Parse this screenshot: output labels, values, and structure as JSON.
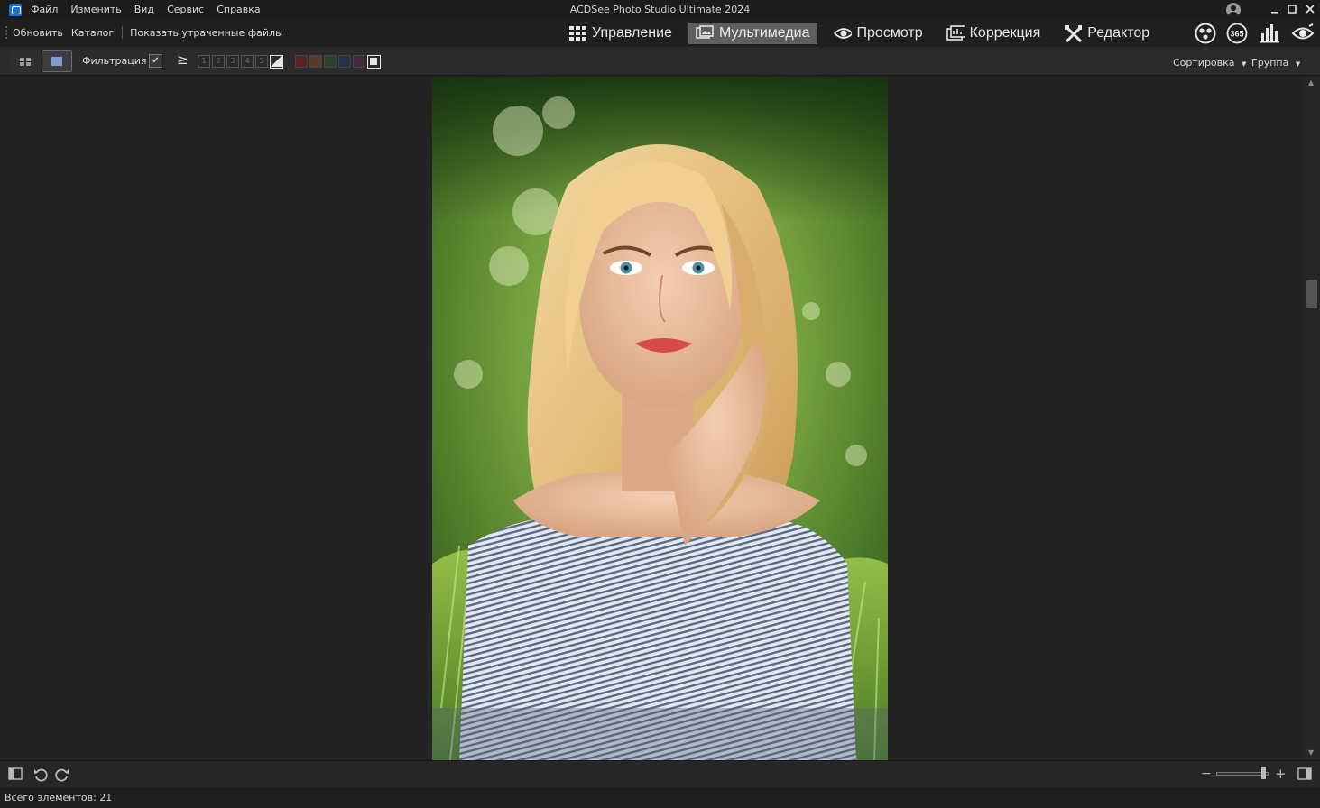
{
  "window": {
    "title": "ACDSee Photo Studio Ultimate 2024"
  },
  "menu": [
    "Файл",
    "Изменить",
    "Вид",
    "Сервис",
    "Справка"
  ],
  "secondary_bar": {
    "refresh": "Обновить",
    "catalog": "Каталог",
    "show_lost": "Показать утраченные файлы"
  },
  "modes": [
    {
      "label": "Управление",
      "icon": "grid-icon",
      "active": false
    },
    {
      "label": "Мультимедиа",
      "icon": "media-icon",
      "active": true
    },
    {
      "label": "Просмотр",
      "icon": "eye-icon",
      "active": false
    },
    {
      "label": "Коррекция",
      "icon": "develop-icon",
      "active": false
    },
    {
      "label": "Редактор",
      "icon": "edit-tools-icon",
      "active": false
    }
  ],
  "toolbar": {
    "filter_label": "Фильтрация",
    "ratings": [
      "1",
      "2",
      "3",
      "4",
      "5"
    ],
    "color_labels": [
      "#5a2323",
      "#5a3a23",
      "#25442a",
      "#23324d",
      "#4a2540"
    ],
    "sort_label": "Сортировка",
    "group_label": "Группа"
  },
  "status": {
    "total": "Всего элементов: 21"
  },
  "zoom": {
    "level": 0.9
  },
  "colors": {
    "active_mode": "#5f5f5f",
    "accent": "#1e6fd0"
  }
}
